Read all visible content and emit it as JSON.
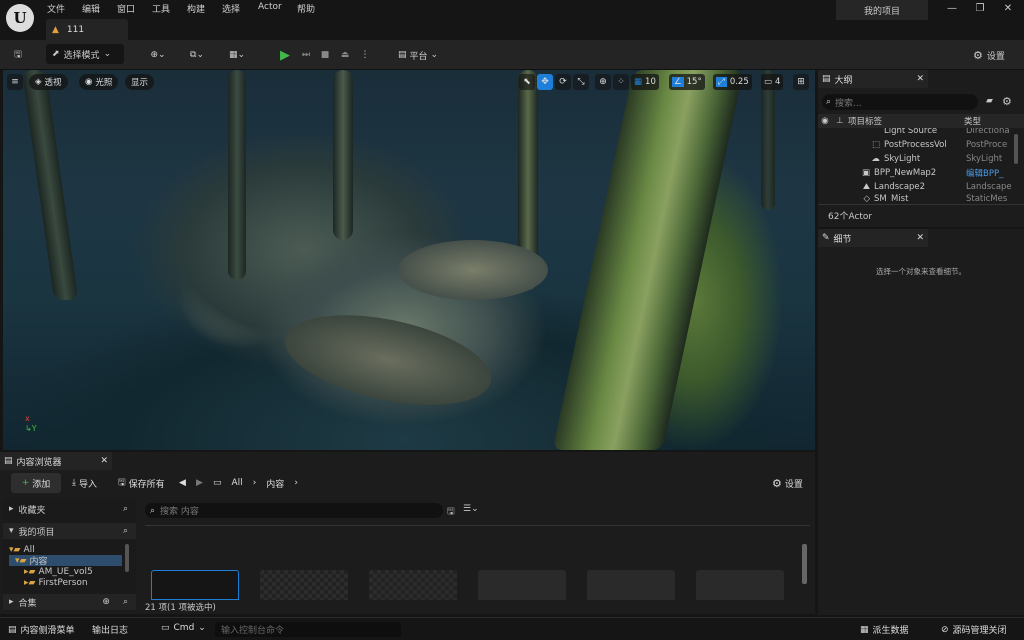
{
  "menu": [
    "文件",
    "编辑",
    "窗口",
    "工具",
    "构建",
    "选择",
    "Actor",
    "帮助"
  ],
  "tab": {
    "label": "111"
  },
  "project_name": "我的项目",
  "toolbar": {
    "select_mode": "选择模式",
    "platform": "平台",
    "settings": "设置"
  },
  "viewport": {
    "perspective": "透视",
    "lit": "光照",
    "show": "显示",
    "grid_snap": "10",
    "rot_snap": "15°",
    "scale_snap": "0.25",
    "camera_speed": "4"
  },
  "outliner": {
    "title": "大纲",
    "search_placeholder": "搜索...",
    "col_label": "项目标签",
    "col_type": "类型",
    "rows": [
      {
        "name": "Light Source",
        "type": "Directiona"
      },
      {
        "name": "PostProcessVol",
        "type": "PostProce"
      },
      {
        "name": "SkyLight",
        "type": "SkyLight"
      },
      {
        "name": "BPP_NewMap2",
        "type": "编辑BPP_"
      },
      {
        "name": "Landscape2",
        "type": "Landscape"
      },
      {
        "name": "SM_Mist",
        "type": "StaticMes"
      }
    ],
    "count": "62个Actor"
  },
  "details": {
    "title": "细节",
    "empty": "选择一个对象来查看细节。"
  },
  "content_browser": {
    "title": "内容浏览器",
    "add": "添加",
    "import": "导入",
    "save_all": "保存所有",
    "path": [
      "All",
      "内容"
    ],
    "settings": "设置",
    "favorites": "收藏夹",
    "my_project": "我的项目",
    "search_placeholder": "搜索 内容",
    "tree": [
      {
        "label": "All"
      },
      {
        "label": "内容"
      },
      {
        "label": "AM_UE_vol5"
      },
      {
        "label": "FirstPerson"
      }
    ],
    "collections": "合集",
    "item_count": "21 项(1 项被选中)"
  },
  "statusbar": {
    "drawer": "内容侧滑菜单",
    "output_log": "输出日志",
    "cmd": "Cmd",
    "console_placeholder": "输入控制台命令",
    "derived_data": "派生数据",
    "source_control": "源码管理关闭"
  },
  "colors": {
    "accent": "#1f7fd8",
    "play": "#3fb94a",
    "bg": "#151515"
  }
}
